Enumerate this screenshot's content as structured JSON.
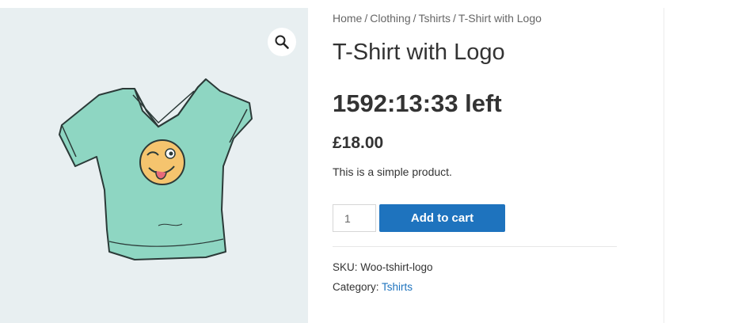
{
  "breadcrumb": {
    "home": "Home",
    "clothing": "Clothing",
    "tshirts": "Tshirts",
    "current": "T-Shirt with Logo",
    "separator": "/"
  },
  "product": {
    "title": "T-Shirt with Logo",
    "countdown": "1592:13:33 left",
    "price": "£18.00",
    "short_description": "This is a simple product.",
    "quantity": "1",
    "add_to_cart_label": "Add to cart",
    "sku_label": "SKU:",
    "sku_value": "Woo-tshirt-logo",
    "category_label": "Category:",
    "category_value": "Tshirts"
  },
  "gallery": {
    "zoom_icon": "magnifier-icon"
  },
  "colors": {
    "accent": "#1e73be",
    "gallery_bg": "#e8eff1",
    "shirt": "#8ed6c2"
  }
}
